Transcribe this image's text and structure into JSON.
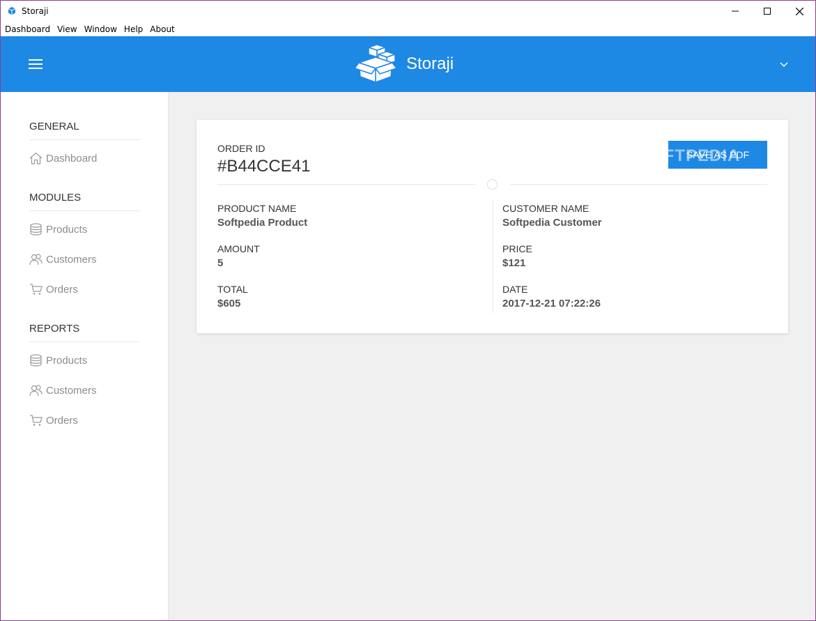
{
  "window": {
    "title": "Storaji",
    "minimize_icon": "minimize-icon",
    "maximize_icon": "maximize-icon",
    "close_icon": "close-icon"
  },
  "menubar": {
    "items": [
      "Dashboard",
      "View",
      "Window",
      "Help",
      "About"
    ]
  },
  "header": {
    "brand": "Storaji",
    "accent_color": "#1e88e5"
  },
  "sidebar": {
    "general": {
      "title": "GENERAL",
      "items": [
        {
          "label": "Dashboard",
          "icon": "home-icon"
        }
      ]
    },
    "modules": {
      "title": "MODULES",
      "items": [
        {
          "label": "Products",
          "icon": "database-icon"
        },
        {
          "label": "Customers",
          "icon": "users-icon"
        },
        {
          "label": "Orders",
          "icon": "cart-icon"
        }
      ]
    },
    "reports": {
      "title": "REPORTS",
      "items": [
        {
          "label": "Products",
          "icon": "database-icon"
        },
        {
          "label": "Customers",
          "icon": "users-icon"
        },
        {
          "label": "Orders",
          "icon": "cart-icon"
        }
      ]
    }
  },
  "order": {
    "id_label": "ORDER ID",
    "id": "#B44CCE41",
    "save_label": "SAVE AS PDF",
    "watermark": "SOFTPEDIA",
    "fields": {
      "product_name": {
        "label": "PRODUCT NAME",
        "value": "Softpedia Product"
      },
      "customer_name": {
        "label": "CUSTOMER NAME",
        "value": "Softpedia Customer"
      },
      "amount": {
        "label": "AMOUNT",
        "value": "5"
      },
      "price": {
        "label": "PRICE",
        "value": "$121"
      },
      "total": {
        "label": "TOTAL",
        "value": "$605"
      },
      "date": {
        "label": "DATE",
        "value": "2017-12-21 07:22:26"
      }
    }
  }
}
